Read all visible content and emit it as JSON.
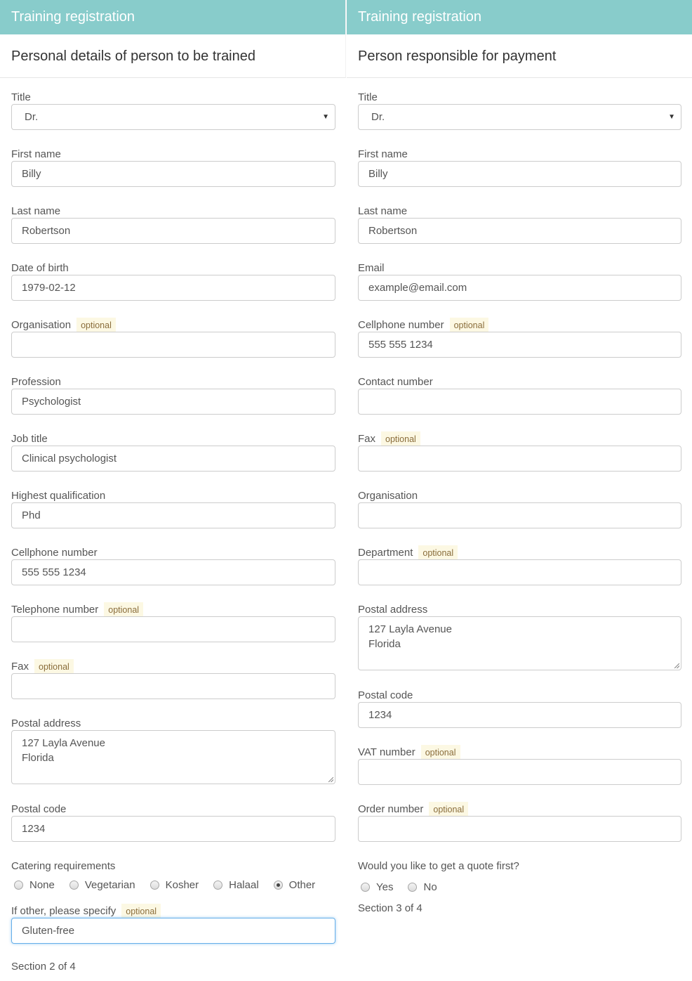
{
  "left": {
    "header": "Training registration",
    "subheader": "Personal details of person to be trained",
    "title": {
      "label": "Title",
      "value": "Dr."
    },
    "first_name": {
      "label": "First name",
      "value": "Billy"
    },
    "last_name": {
      "label": "Last name",
      "value": "Robertson"
    },
    "dob": {
      "label": "Date of birth",
      "value": "1979-02-12"
    },
    "organisation": {
      "label": "Organisation",
      "badge": "optional",
      "value": ""
    },
    "profession": {
      "label": "Profession",
      "value": "Psychologist"
    },
    "job_title": {
      "label": "Job title",
      "value": "Clinical psychologist"
    },
    "qualification": {
      "label": "Highest qualification",
      "value": "Phd"
    },
    "cellphone": {
      "label": "Cellphone number",
      "value": "555 555 1234"
    },
    "telephone": {
      "label": "Telephone number",
      "badge": "optional",
      "value": ""
    },
    "fax": {
      "label": "Fax",
      "badge": "optional",
      "value": ""
    },
    "postal_address": {
      "label": "Postal address",
      "line1": "127 Layla Avenue",
      "line2": "Florida"
    },
    "postal_code": {
      "label": "Postal code",
      "value": "1234"
    },
    "catering": {
      "label": "Catering requirements",
      "options": [
        "None",
        "Vegetarian",
        "Kosher",
        "Halaal",
        "Other"
      ],
      "selected": "Other"
    },
    "other_specify": {
      "label": "If other, please specify",
      "badge": "optional",
      "value": "Gluten-free"
    },
    "section": "Section 2 of 4"
  },
  "right": {
    "header": "Training registration",
    "subheader": "Person responsible for payment",
    "title": {
      "label": "Title",
      "value": "Dr."
    },
    "first_name": {
      "label": "First name",
      "value": "Billy"
    },
    "last_name": {
      "label": "Last name",
      "value": "Robertson"
    },
    "email": {
      "label": "Email",
      "value": "example@email.com"
    },
    "cellphone": {
      "label": "Cellphone number",
      "badge": "optional",
      "value": "555 555 1234"
    },
    "contact": {
      "label": "Contact number",
      "value": ""
    },
    "fax": {
      "label": "Fax",
      "badge": "optional",
      "value": ""
    },
    "organisation": {
      "label": "Organisation",
      "value": ""
    },
    "department": {
      "label": "Department",
      "badge": "optional",
      "value": ""
    },
    "postal_address": {
      "label": "Postal address",
      "line1": "127 Layla Avenue",
      "line2": "Florida"
    },
    "postal_code": {
      "label": "Postal code",
      "value": "1234"
    },
    "vat": {
      "label": "VAT number",
      "badge": "optional",
      "value": ""
    },
    "order": {
      "label": "Order number",
      "badge": "optional",
      "value": ""
    },
    "quote": {
      "label": "Would you like to get a quote first?",
      "options": [
        "Yes",
        "No"
      ],
      "selected": ""
    },
    "section": "Section 3 of 4"
  },
  "colors": {
    "header_bg": "#88cccb",
    "badge_bg": "#fcf8e3",
    "focus": "#66afe9"
  }
}
